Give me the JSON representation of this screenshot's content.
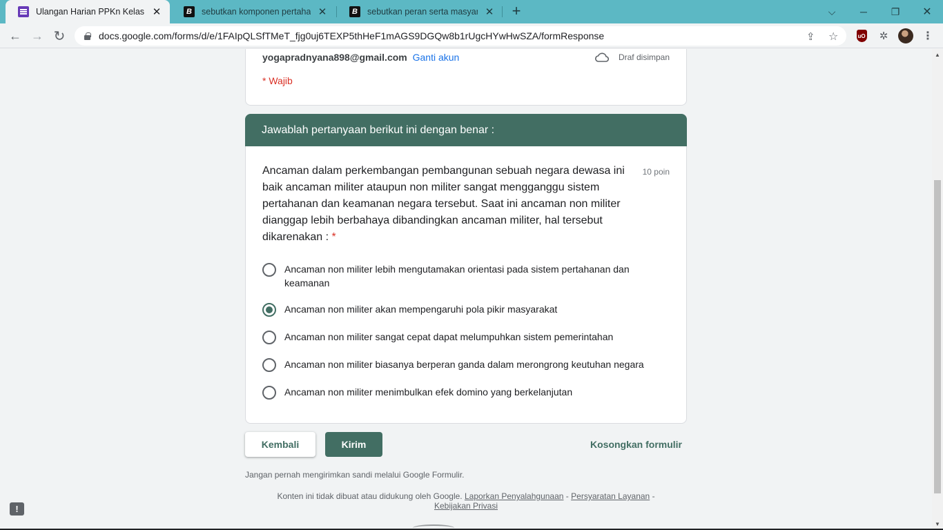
{
  "browser": {
    "tabs": [
      {
        "title": "Ulangan Harian PPKn Kelas X-VI",
        "favicon": "google-forms-icon",
        "active": true
      },
      {
        "title": "sebutkan komponen pertahanan",
        "favicon": "brainly-icon",
        "active": false
      },
      {
        "title": "sebutkan peran serta masyarakat",
        "favicon": "brainly-icon",
        "active": false
      }
    ],
    "url": "docs.google.com/forms/d/e/1FAIpQLSfTMeT_fjg0uj6TEXP5thHeF1mAGS9DGQw8b1rUgcHYwHwSZA/formResponse",
    "icons": {
      "new_tab": "+",
      "close": "✕",
      "back": "←",
      "forward": "→",
      "reload": "↻",
      "share": "⇪",
      "star": "☆",
      "extensions": "✲",
      "menu": "⋮",
      "dropdown": "⌵",
      "minimize": "─",
      "restore": "❐",
      "ublock": "uO"
    }
  },
  "form": {
    "account_email": "yogapradnyana898@gmail.com",
    "switch_account": "Ganti akun",
    "draft_status": "Draf disimpan",
    "required_note": "* Wajib",
    "section_title": "Jawablah pertanyaan berikut ini dengan benar :",
    "question": {
      "text": "Ancaman dalam perkembangan pembangunan sebuah negara dewasa ini baik ancaman militer ataupun non militer sangat mengganggu sistem pertahanan dan keamanan negara tersebut. Saat ini ancaman non militer dianggap lebih berbahaya dibandingkan ancaman militer, hal tersebut dikarenakan :",
      "required_mark": "*",
      "points": "10 poin",
      "options": [
        {
          "label": "Ancaman non militer lebih mengutamakan orientasi pada sistem pertahanan dan keamanan",
          "selected": false
        },
        {
          "label": "Ancaman non militer akan mempengaruhi pola pikir masyarakat",
          "selected": true
        },
        {
          "label": "Ancaman non militer sangat cepat dapat melumpuhkan sistem pemerintahan",
          "selected": false
        },
        {
          "label": "Ancaman non militer biasanya berperan ganda dalam merongrong keutuhan negara",
          "selected": false
        },
        {
          "label": "Ancaman non militer menimbulkan efek domino yang berkelanjutan",
          "selected": false
        }
      ]
    },
    "buttons": {
      "back": "Kembali",
      "submit": "Kirim",
      "clear": "Kosongkan formulir"
    },
    "footnote": "Jangan pernah mengirimkan sandi melalui Google Formulir.",
    "legal": {
      "prefix": "Konten ini tidak dibuat atau didukung oleh Google.",
      "report": "Laporkan Penyalahgunaan",
      "sep": "-",
      "terms": "Persyaratan Layanan",
      "privacy": "Kebijakan Privasi"
    },
    "report_icon": "!"
  },
  "colors": {
    "theme": "#426e63",
    "tabstrip": "#5cb8c4",
    "required": "#d93025",
    "link": "#1a73e8"
  }
}
